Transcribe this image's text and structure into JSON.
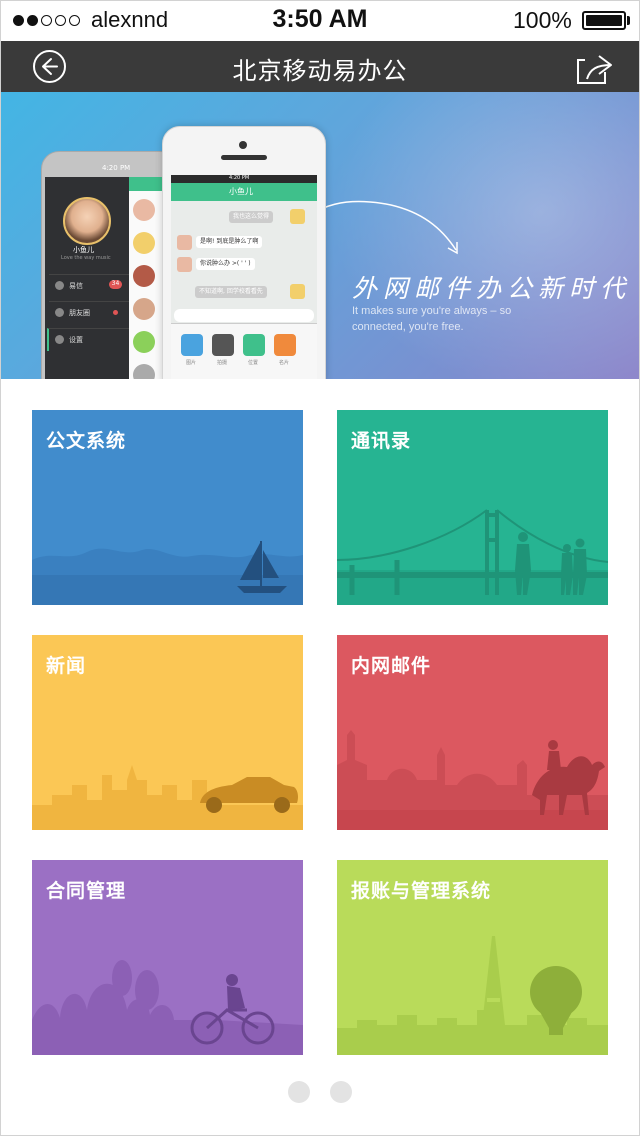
{
  "status_bar": {
    "carrier": "alexnnd",
    "time": "3:50 AM",
    "battery_percent": "100%",
    "signal_bars_filled": 2,
    "signal_bars_total": 5
  },
  "nav": {
    "title": "北京移动易办公",
    "back_icon": "back-arrow-circle-icon",
    "share_icon": "share-icon"
  },
  "banner": {
    "slogan": "外网邮件办公新时代",
    "slogan_sub": "It makes sure you're always – so connected, you're free.",
    "back_phone": {
      "time": "4:20 PM",
      "profile_name": "小鱼儿",
      "profile_sub": "Love the way music",
      "menu": [
        {
          "label": "易信",
          "badge": "34"
        },
        {
          "label": "朋友圈",
          "badge": ""
        },
        {
          "label": "设置",
          "badge": ""
        }
      ]
    },
    "front_phone": {
      "time": "4:20 PM",
      "chat_title": "小鱼儿",
      "messages": [
        {
          "side": "right",
          "text": "我也这么觉得"
        },
        {
          "side": "left",
          "text": "是啊! 到底是肿么了啊"
        },
        {
          "side": "left",
          "text": "你说肿么办 >( ' ' )"
        },
        {
          "side": "right",
          "text": "不知道啊, 回学校看看先"
        }
      ],
      "tools": [
        "图片",
        "拍摄",
        "位置",
        "名片"
      ]
    }
  },
  "tiles": [
    {
      "label": "公文系统",
      "color": "#418ccc",
      "scene": "sea-boat"
    },
    {
      "label": "通讯录",
      "color": "#26b492",
      "scene": "bridge-people"
    },
    {
      "label": "新闻",
      "color": "#fbc755",
      "scene": "city-car"
    },
    {
      "label": "内网邮件",
      "color": "#dc5860",
      "scene": "desert-camel"
    },
    {
      "label": "合同管理",
      "color": "#9b70c4",
      "scene": "park-cyclist"
    },
    {
      "label": "报账与管理系统",
      "color": "#b9db5a",
      "scene": "paris-balloon"
    }
  ],
  "pager": {
    "pages": 2,
    "active": 0
  }
}
